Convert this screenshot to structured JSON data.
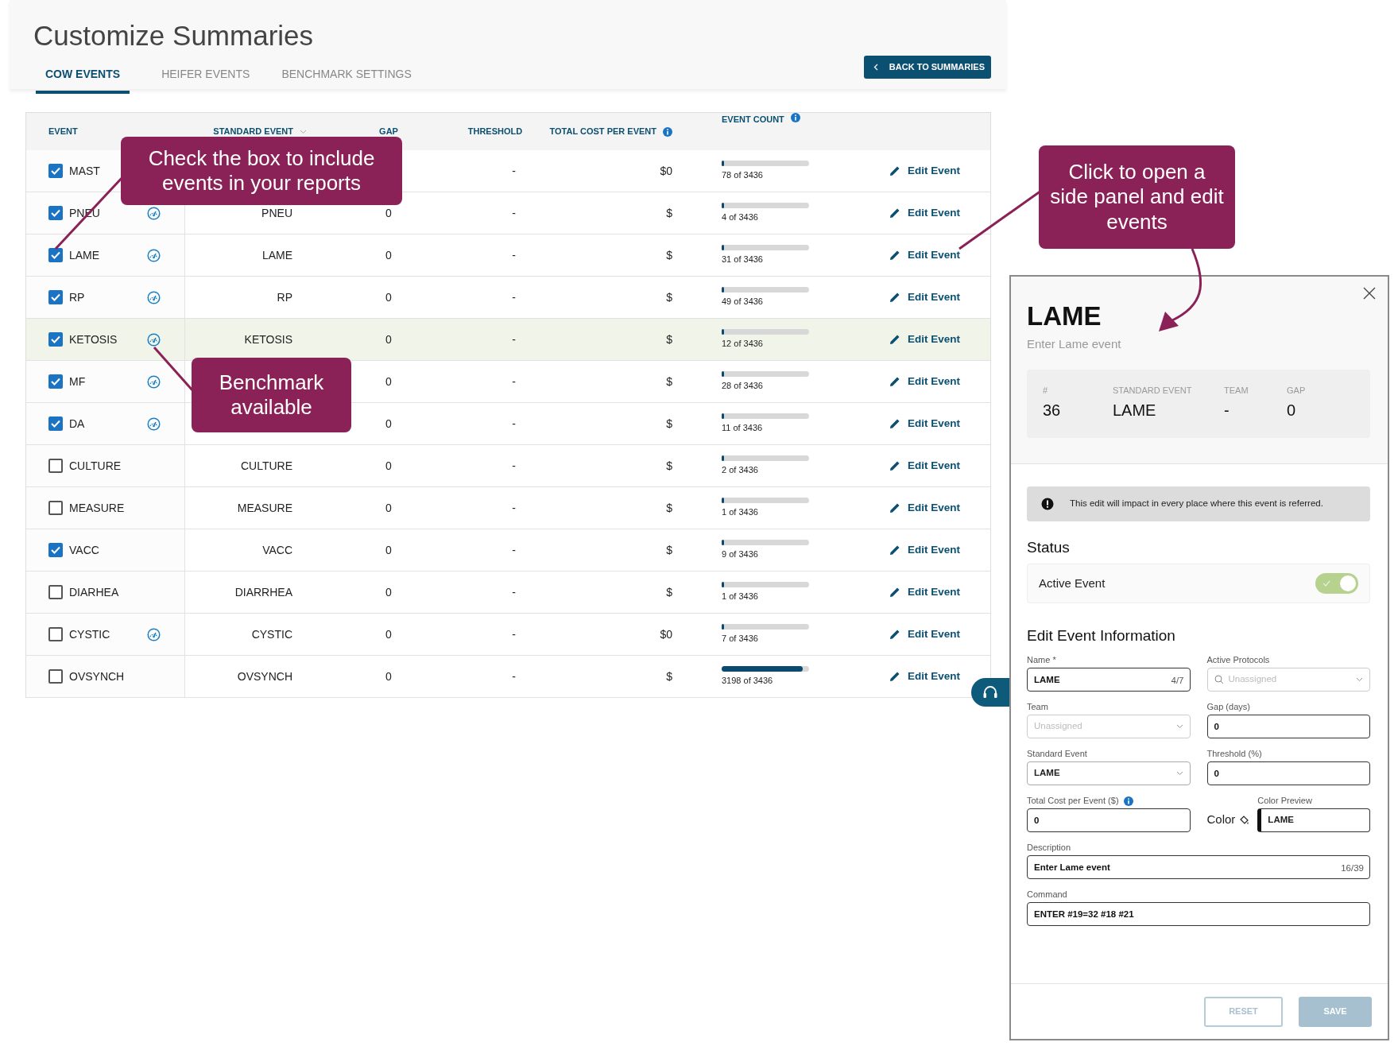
{
  "page": {
    "title": "Customize Summaries"
  },
  "tabs": [
    {
      "label": "COW EVENTS",
      "selected": true
    },
    {
      "label": "HEIFER EVENTS",
      "selected": false
    },
    {
      "label": "BENCHMARK SETTINGS",
      "selected": false
    }
  ],
  "back_button": {
    "label": "BACK TO SUMMARIES"
  },
  "table": {
    "columns": [
      {
        "label": "EVENT"
      },
      {
        "label": "STANDARD EVENT",
        "sortable": true
      },
      {
        "label": "GAP"
      },
      {
        "label": "THRESHOLD"
      },
      {
        "label": "TOTAL COST PER EVENT",
        "info": true
      },
      {
        "label": "EVENT COUNT",
        "info": true
      }
    ],
    "rows": [
      {
        "event": "MAST",
        "checked": true,
        "benchmark": false,
        "threshold": "-",
        "cost": "$0",
        "count": "78 of 3436",
        "level": 0.023,
        "action": "Edit Event",
        "highlighted": false,
        "faded": false
      },
      {
        "event": "PNEU",
        "checked": true,
        "benchmark": true,
        "standard": "PNEU",
        "gap": "0",
        "threshold": "-",
        "cost": "$",
        "count": "4 of 3436",
        "level": 0.001,
        "action": "Edit Event",
        "highlighted": false,
        "faded": false
      },
      {
        "event": "LAME",
        "checked": true,
        "benchmark": true,
        "standard": "LAME",
        "gap": "0",
        "threshold": "-",
        "cost": "$",
        "count": "31 of 3436",
        "level": 0.009,
        "action": "Edit Event",
        "highlighted": false,
        "faded": false
      },
      {
        "event": "RP",
        "checked": true,
        "benchmark": true,
        "standard": "RP",
        "gap": "0",
        "threshold": "-",
        "cost": "$",
        "count": "49 of 3436",
        "level": 0.014,
        "action": "Edit Event",
        "highlighted": false,
        "faded": false
      },
      {
        "event": "KETOSIS",
        "checked": true,
        "benchmark": true,
        "standard": "KETOSIS",
        "gap": "0",
        "threshold": "-",
        "cost": "$",
        "count": "12 of 3436",
        "level": 0.003,
        "action": "Edit Event",
        "highlighted": true,
        "faded": false
      },
      {
        "event": "MF",
        "checked": true,
        "benchmark": true,
        "gap": "0",
        "threshold": "-",
        "cost": "$",
        "count": "28 of 3436",
        "level": 0.008,
        "action": "Edit Event",
        "highlighted": false,
        "faded": false
      },
      {
        "event": "DA",
        "checked": true,
        "benchmark": true,
        "gap": "0",
        "threshold": "-",
        "cost": "$",
        "count": "11 of 3436",
        "level": 0.003,
        "action": "Edit Event",
        "highlighted": false,
        "faded": false
      },
      {
        "event": "CULTURE",
        "checked": false,
        "benchmark": false,
        "standard": "CULTURE",
        "gap": "0",
        "threshold": "-",
        "cost": "$",
        "count": "2 of 3436",
        "level": 0.001,
        "action": "Edit Event",
        "highlighted": false,
        "faded": false
      },
      {
        "event": "MEASURE",
        "checked": false,
        "benchmark": false,
        "standard": "MEASURE",
        "gap": "0",
        "threshold": "-",
        "cost": "$",
        "count": "1 of 3436",
        "level": 0.0003,
        "action": "Edit Event",
        "highlighted": false,
        "faded": false
      },
      {
        "event": "VACC",
        "checked": true,
        "benchmark": false,
        "standard": "VACC",
        "gap": "0",
        "threshold": "-",
        "cost": "$",
        "count": "9 of 3436",
        "level": 0.003,
        "action": "Edit Event",
        "highlighted": false,
        "faded": false
      },
      {
        "event": "DIARHEA",
        "checked": false,
        "benchmark": false,
        "standard": "DIARRHEA",
        "gap": "0",
        "threshold": "-",
        "cost": "$",
        "count": "1 of 3436",
        "level": 0.0003,
        "action": "Edit Event",
        "highlighted": false,
        "faded": false
      },
      {
        "event": "CYSTIC",
        "checked": false,
        "benchmark": true,
        "standard": "CYSTIC",
        "gap": "0",
        "threshold": "-",
        "cost": "$0",
        "count": "7 of 3436",
        "level": 0.002,
        "action": "Edit Event",
        "highlighted": false,
        "faded": false
      },
      {
        "event": "OVSYNCH",
        "checked": false,
        "benchmark": false,
        "standard": "OVSYNCH",
        "gap": "0",
        "threshold": "-",
        "cost": "$",
        "count": "3198 of 3436",
        "level": 0.931,
        "action": "Edit Event",
        "highlighted": false,
        "faded": false
      }
    ]
  },
  "callouts": [
    {
      "text": "Check the box to include events in your reports"
    },
    {
      "text": "Benchmark available"
    },
    {
      "text": "Click to open a side panel and edit events"
    }
  ],
  "panel": {
    "title": "LAME",
    "subtitle": "Enter Lame event",
    "summary": [
      {
        "label": "#",
        "value": "36"
      },
      {
        "label": "STANDARD EVENT",
        "value": "LAME"
      },
      {
        "label": "TEAM",
        "value": "-"
      },
      {
        "label": "GAP",
        "value": "0"
      }
    ],
    "notice": "This edit will impact in every place where this event is referred.",
    "status_heading": "Status",
    "status": {
      "label": "Active Event",
      "on": true
    },
    "form_heading": "Edit Event Information",
    "fields": [
      {
        "kind": "text",
        "label": "Name *",
        "value": "LAME",
        "counter": "4/7"
      },
      {
        "kind": "search-select",
        "label": "Active Protocols",
        "placeholder": "Unassigned"
      },
      {
        "kind": "select",
        "label": "Team",
        "placeholder": "Unassigned"
      },
      {
        "kind": "text",
        "label": "Gap (days)",
        "value": "0"
      },
      {
        "kind": "select",
        "label": "Standard Event",
        "value": "LAME"
      },
      {
        "kind": "text",
        "label": "Threshold (%)",
        "value": "0"
      },
      {
        "kind": "text",
        "label": "Total Cost per Event ($)",
        "value": "0",
        "info": true
      },
      {
        "kind": "color",
        "label": "Color Preview",
        "button": "Color",
        "value": "LAME"
      },
      {
        "kind": "text",
        "label": "Description",
        "value": "Enter Lame event",
        "counter": "16/39",
        "wide": true
      },
      {
        "kind": "text",
        "label": "Command",
        "value": "ENTER #19=32 #18 #21",
        "wide": true
      }
    ],
    "buttons": [
      {
        "label": "RESET",
        "kind": "outline",
        "disabled": true
      },
      {
        "label": "SAVE",
        "kind": "primary",
        "disabled": true
      }
    ]
  }
}
